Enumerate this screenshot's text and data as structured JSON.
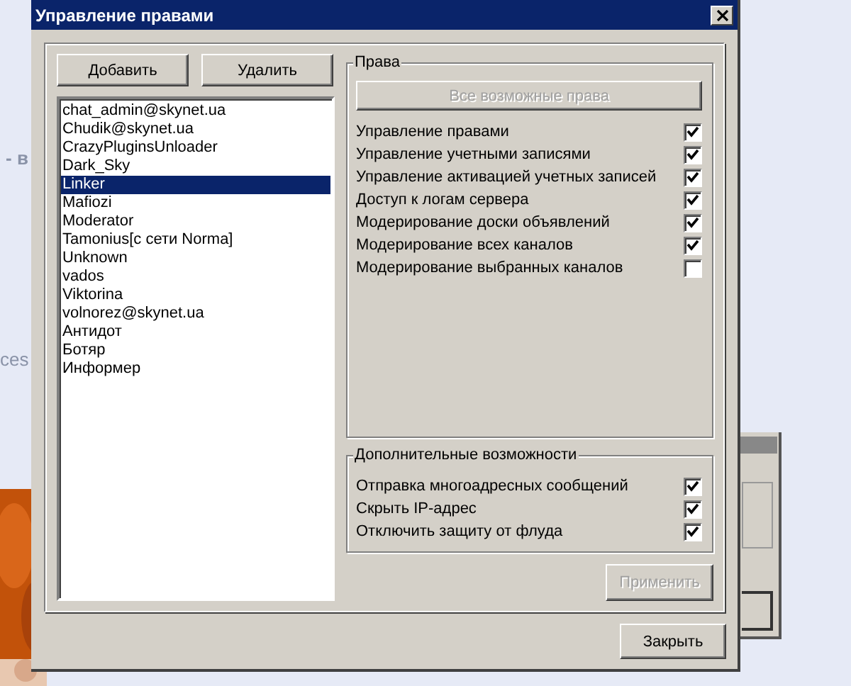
{
  "background": {
    "texts": [
      "- в",
      "ces"
    ]
  },
  "window": {
    "title": "Управление правами"
  },
  "user_buttons": [
    {
      "label": "Добавить"
    },
    {
      "label": "Удалить"
    }
  ],
  "users": [
    {
      "name": "chat_admin@skynet.ua",
      "selected": false
    },
    {
      "name": "Chudik@skynet.ua",
      "selected": false
    },
    {
      "name": "CrazyPluginsUnloader",
      "selected": false
    },
    {
      "name": "Dark_Sky",
      "selected": false
    },
    {
      "name": "Linker",
      "selected": true
    },
    {
      "name": "Mafiozi",
      "selected": false
    },
    {
      "name": "Moderator",
      "selected": false
    },
    {
      "name": "Tamonius[c сети Norma]",
      "selected": false
    },
    {
      "name": "Unknown",
      "selected": false
    },
    {
      "name": "vados",
      "selected": false
    },
    {
      "name": "Viktorina",
      "selected": false
    },
    {
      "name": "volnorez@skynet.ua",
      "selected": false
    },
    {
      "name": "Антидот",
      "selected": false
    },
    {
      "name": "Ботяр",
      "selected": false
    },
    {
      "name": "Информер",
      "selected": false
    }
  ],
  "rights": {
    "title": "Права",
    "all_button": {
      "label": "Все возможные права",
      "disabled": true
    },
    "items": [
      {
        "label": "Управление правами",
        "checked": true
      },
      {
        "label": "Управление учетными записями",
        "checked": true
      },
      {
        "label": "Управление активацией учетных записей",
        "checked": true
      },
      {
        "label": "Доступ к логам сервера",
        "checked": true
      },
      {
        "label": "Модерирование доски объявлений",
        "checked": true
      },
      {
        "label": "Модерирование всех каналов",
        "checked": true
      },
      {
        "label": "Модерирование выбранных каналов",
        "checked": false
      }
    ]
  },
  "extras": {
    "title": "Дополнительные возможности",
    "items": [
      {
        "label": "Отправка многоадресных сообщений",
        "checked": true
      },
      {
        "label": "Скрыть IP-адрес",
        "checked": true
      },
      {
        "label": "Отключить защиту от флуда",
        "checked": true
      }
    ]
  },
  "apply_button": {
    "label": "Применить",
    "disabled": true
  },
  "close_button": {
    "label": "Закрыть"
  }
}
